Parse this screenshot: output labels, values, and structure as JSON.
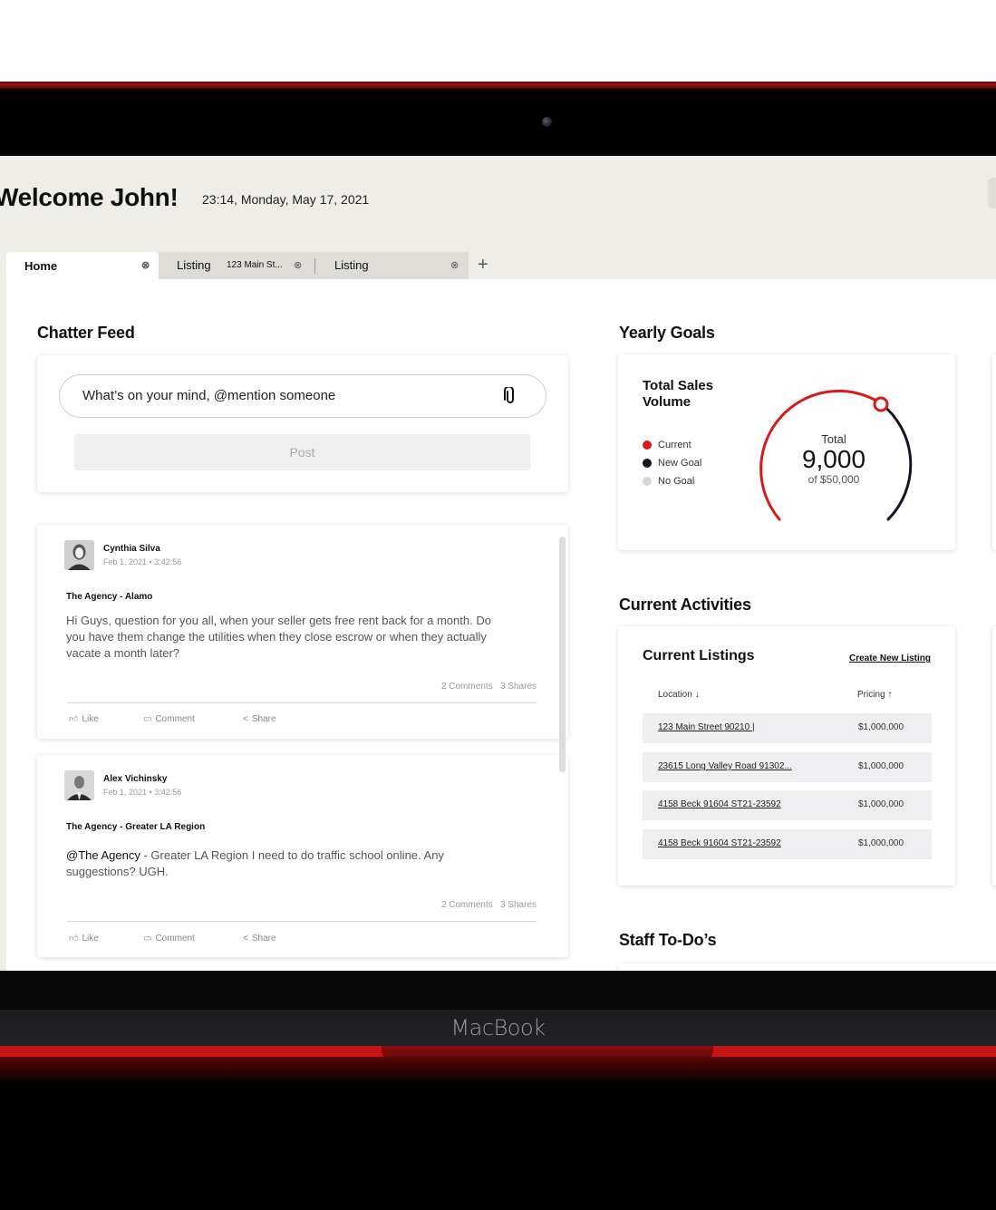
{
  "device": {
    "brand": "MacBook"
  },
  "header": {
    "welcome": "Welcome John!",
    "datetime": "23:14, Monday, May 17, 2021"
  },
  "tabs": [
    {
      "label": "Home",
      "sub": ""
    },
    {
      "label": "Listing",
      "sub": "123 Main St..."
    },
    {
      "label": "Listing",
      "sub": ""
    }
  ],
  "tab_add": "+",
  "chatter": {
    "title": "Chatter Feed",
    "input_placeholder": "What’s on your mind, @mention someone",
    "post_label": "Post",
    "posts": [
      {
        "author": "Cynthia Silva",
        "date": "Feb 1, 2021",
        "time": "3:42:56",
        "group": "The Agency - Alamo",
        "mention": "",
        "body": "Hi Guys, question for you all, when your seller gets free rent back for a month. Do you have them change the utilities when they close escrow or when they actually vacate a month later?",
        "comments": "2 Comments",
        "shares": "3 Shares",
        "like": "Like",
        "comment": "Comment",
        "share": "Share"
      },
      {
        "author": "Alex Vichinsky",
        "date": "Feb 1, 2021",
        "time": "3:42:56",
        "group": "The Agency - Greater LA Region",
        "mention": "@The Agency",
        "body": " - Greater LA Region I need to do traffic school online. Any suggestions? UGH.",
        "comments": "2 Comments",
        "shares": "3 Shares",
        "like": "Like",
        "comment": "Comment",
        "share": "Share"
      }
    ]
  },
  "goals": {
    "title": "Yearly Goals",
    "card_title": "Total Sales Volume",
    "legend": [
      {
        "label": "Current",
        "color": "#d71a1a"
      },
      {
        "label": "New Goal",
        "color": "#15152a"
      },
      {
        "label": "No Goal",
        "color": "#d6d6d6"
      }
    ],
    "gauge_label": "Total",
    "gauge_value": "9,000",
    "gauge_of": "of $50,000"
  },
  "activities": {
    "title": "Current Activities",
    "listings_title": "Current Listings",
    "create_link": "Create New Listing",
    "col_location": "Location",
    "col_pricing": "Pricing",
    "rows": [
      {
        "location": "123 Main Street 90210  |",
        "price": "$1,000,000"
      },
      {
        "location": "23615 Long Valley Road 91302...",
        "price": "$1,000,000"
      },
      {
        "location": "4158 Beck 91604 ST21-23592",
        "price": "$1,000,000"
      },
      {
        "location": "4158 Beck 91604 ST21-23592",
        "price": "$1,000,000"
      }
    ]
  },
  "staff": {
    "title": "Staff To-Do’s"
  },
  "colors": {
    "accent_red": "#d71a1a",
    "navy": "#15152a"
  }
}
